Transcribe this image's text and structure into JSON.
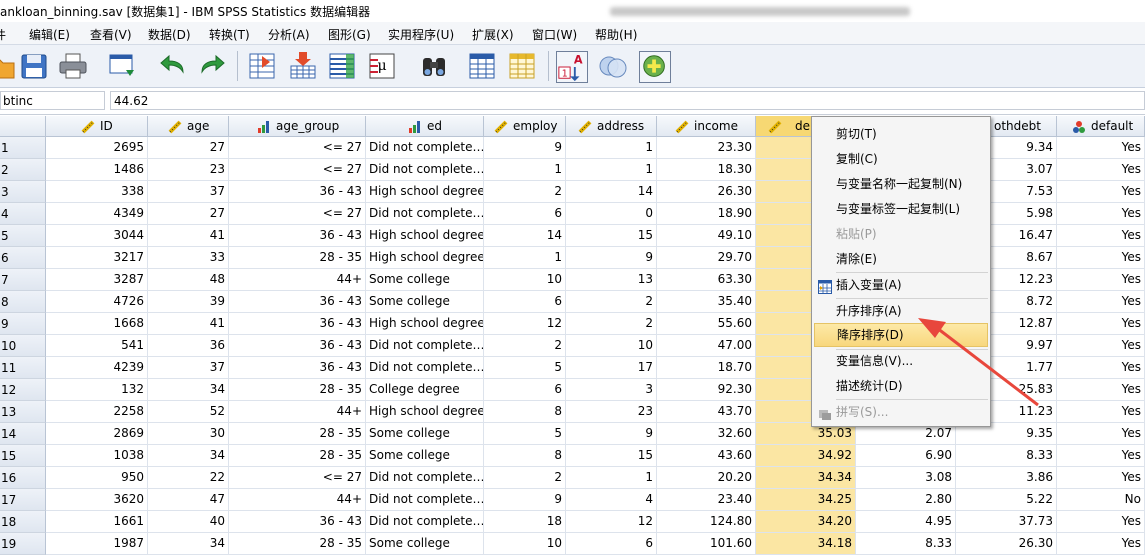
{
  "window": {
    "title": "ankloan_binning.sav [数据集1] - IBM SPSS Statistics 数据编辑器"
  },
  "menu": [
    {
      "label": "件"
    },
    {
      "label": "编辑(E)"
    },
    {
      "label": "查看(V)"
    },
    {
      "label": "数据(D)"
    },
    {
      "label": "转换(T)"
    },
    {
      "label": "分析(A)"
    },
    {
      "label": "图形(G)"
    },
    {
      "label": "实用程序(U)"
    },
    {
      "label": "扩展(X)"
    },
    {
      "label": "窗口(W)"
    },
    {
      "label": "帮助(H)"
    }
  ],
  "toolbar_icons": [
    "open-icon",
    "save-icon",
    "print-icon",
    "dialog-recall-icon",
    "undo-icon",
    "redo-icon",
    "goto-case-icon",
    "goto-variable-icon",
    "variables-icon",
    "value-labels-icon",
    "find-icon",
    "insert-cases-icon",
    "insert-variable-icon",
    "split-file-icon",
    "weight-cases-icon",
    "select-cases-icon",
    "use-sets-icon"
  ],
  "cell_editor": {
    "name": "btinc",
    "value": "44.62"
  },
  "colors": {
    "selected_column": "#fbe6a3",
    "selected_header": "#f7d873",
    "arrow": "#e8473c"
  },
  "columns": [
    {
      "name": "ID",
      "type": "scale"
    },
    {
      "name": "age",
      "type": "scale"
    },
    {
      "name": "age_group",
      "type": "ordinal"
    },
    {
      "name": "ed",
      "type": "ordinal"
    },
    {
      "name": "employ",
      "type": "scale"
    },
    {
      "name": "address",
      "type": "scale"
    },
    {
      "name": "income",
      "type": "scale"
    },
    {
      "name": "del",
      "type": "scale"
    },
    {
      "name": "",
      "type": "scale"
    },
    {
      "name": "othdebt",
      "type": "scale"
    },
    {
      "name": "default",
      "type": "nominal"
    }
  ],
  "rows": [
    {
      "n": "1",
      "ID": "2695",
      "age": "27",
      "age_group": "<= 27",
      "ed": "Did not complete…",
      "employ": "9",
      "address": "1",
      "income": "23.30",
      "debtinc": "",
      "creddebt": "",
      "othdebt": "9.34",
      "default": "Yes"
    },
    {
      "n": "2",
      "ID": "1486",
      "age": "23",
      "age_group": "<= 27",
      "ed": "Did not complete…",
      "employ": "1",
      "address": "1",
      "income": "18.30",
      "debtinc": "",
      "creddebt": "",
      "othdebt": "3.07",
      "default": "Yes"
    },
    {
      "n": "3",
      "ID": "338",
      "age": "37",
      "age_group": "36 - 43",
      "ed": "High school degree",
      "employ": "2",
      "address": "14",
      "income": "26.30",
      "debtinc": "",
      "creddebt": "",
      "othdebt": "7.53",
      "default": "Yes"
    },
    {
      "n": "4",
      "ID": "4349",
      "age": "27",
      "age_group": "<= 27",
      "ed": "Did not complete…",
      "employ": "6",
      "address": "0",
      "income": "18.90",
      "debtinc": "",
      "creddebt": "",
      "othdebt": "5.98",
      "default": "Yes"
    },
    {
      "n": "5",
      "ID": "3044",
      "age": "41",
      "age_group": "36 - 43",
      "ed": "High school degree",
      "employ": "14",
      "address": "15",
      "income": "49.10",
      "debtinc": "",
      "creddebt": "",
      "othdebt": "16.47",
      "default": "Yes"
    },
    {
      "n": "6",
      "ID": "3217",
      "age": "33",
      "age_group": "28 - 35",
      "ed": "High school degree",
      "employ": "1",
      "address": "9",
      "income": "29.70",
      "debtinc": "",
      "creddebt": "",
      "othdebt": "8.67",
      "default": "Yes"
    },
    {
      "n": "7",
      "ID": "3287",
      "age": "48",
      "age_group": "44+",
      "ed": "Some college",
      "employ": "10",
      "address": "13",
      "income": "63.30",
      "debtinc": "",
      "creddebt": "",
      "othdebt": "12.23",
      "default": "Yes"
    },
    {
      "n": "8",
      "ID": "4726",
      "age": "39",
      "age_group": "36 - 43",
      "ed": "Some college",
      "employ": "6",
      "address": "2",
      "income": "35.40",
      "debtinc": "",
      "creddebt": "",
      "othdebt": "8.72",
      "default": "Yes"
    },
    {
      "n": "9",
      "ID": "1668",
      "age": "41",
      "age_group": "36 - 43",
      "ed": "High school degree",
      "employ": "12",
      "address": "2",
      "income": "55.60",
      "debtinc": "",
      "creddebt": "",
      "othdebt": "12.87",
      "default": "Yes"
    },
    {
      "n": "10",
      "ID": "541",
      "age": "36",
      "age_group": "36 - 43",
      "ed": "Did not complete…",
      "employ": "2",
      "address": "10",
      "income": "47.00",
      "debtinc": "",
      "creddebt": "",
      "othdebt": "9.97",
      "default": "Yes"
    },
    {
      "n": "11",
      "ID": "4239",
      "age": "37",
      "age_group": "36 - 43",
      "ed": "Did not complete…",
      "employ": "5",
      "address": "17",
      "income": "18.70",
      "debtinc": "",
      "creddebt": "",
      "othdebt": "1.77",
      "default": "Yes"
    },
    {
      "n": "12",
      "ID": "132",
      "age": "34",
      "age_group": "28 - 35",
      "ed": "College degree",
      "employ": "6",
      "address": "3",
      "income": "92.30",
      "debtinc": "",
      "creddebt": "",
      "othdebt": "25.83",
      "default": "Yes"
    },
    {
      "n": "13",
      "ID": "2258",
      "age": "52",
      "age_group": "44+",
      "ed": "High school degree",
      "employ": "8",
      "address": "23",
      "income": "43.70",
      "debtinc": "",
      "creddebt": "",
      "othdebt": "11.23",
      "default": "Yes"
    },
    {
      "n": "14",
      "ID": "2869",
      "age": "30",
      "age_group": "28 - 35",
      "ed": "Some college",
      "employ": "5",
      "address": "9",
      "income": "32.60",
      "debtinc": "35.03",
      "creddebt": "2.07",
      "othdebt": "9.35",
      "default": "Yes"
    },
    {
      "n": "15",
      "ID": "1038",
      "age": "34",
      "age_group": "28 - 35",
      "ed": "Some college",
      "employ": "8",
      "address": "15",
      "income": "43.60",
      "debtinc": "34.92",
      "creddebt": "6.90",
      "othdebt": "8.33",
      "default": "Yes"
    },
    {
      "n": "16",
      "ID": "950",
      "age": "22",
      "age_group": "<= 27",
      "ed": "Did not complete…",
      "employ": "2",
      "address": "1",
      "income": "20.20",
      "debtinc": "34.34",
      "creddebt": "3.08",
      "othdebt": "3.86",
      "default": "Yes"
    },
    {
      "n": "17",
      "ID": "3620",
      "age": "47",
      "age_group": "44+",
      "ed": "Did not complete…",
      "employ": "9",
      "address": "4",
      "income": "23.40",
      "debtinc": "34.25",
      "creddebt": "2.80",
      "othdebt": "5.22",
      "default": "No"
    },
    {
      "n": "18",
      "ID": "1661",
      "age": "40",
      "age_group": "36 - 43",
      "ed": "Did not complete…",
      "employ": "18",
      "address": "12",
      "income": "124.80",
      "debtinc": "34.20",
      "creddebt": "4.95",
      "othdebt": "37.73",
      "default": "Yes"
    },
    {
      "n": "19",
      "ID": "1987",
      "age": "34",
      "age_group": "28 - 35",
      "ed": "Some college",
      "employ": "10",
      "address": "6",
      "income": "101.60",
      "debtinc": "34.18",
      "creddebt": "8.33",
      "othdebt": "26.30",
      "default": "Yes"
    }
  ],
  "context_menu": {
    "items": [
      {
        "label": "剪切(T)",
        "enabled": true
      },
      {
        "label": "复制(C)",
        "enabled": true
      },
      {
        "label": "与变量名称一起复制(N)",
        "enabled": true
      },
      {
        "label": "与变量标签一起复制(L)",
        "enabled": true
      },
      {
        "label": "粘贴(P)",
        "enabled": false
      },
      {
        "label": "清除(E)",
        "enabled": true
      },
      {
        "label": "插入变量(A)",
        "enabled": true,
        "icon": "insert-variable-icon"
      },
      {
        "label": "升序排序(A)",
        "enabled": true
      },
      {
        "label": "降序排序(D)",
        "enabled": true,
        "highlighted": true
      },
      {
        "label": "变量信息(V)...",
        "enabled": true
      },
      {
        "label": "描述统计(D)",
        "enabled": true
      },
      {
        "label": "拼写(S)...",
        "enabled": false,
        "icon": "spelling-icon"
      }
    ]
  }
}
